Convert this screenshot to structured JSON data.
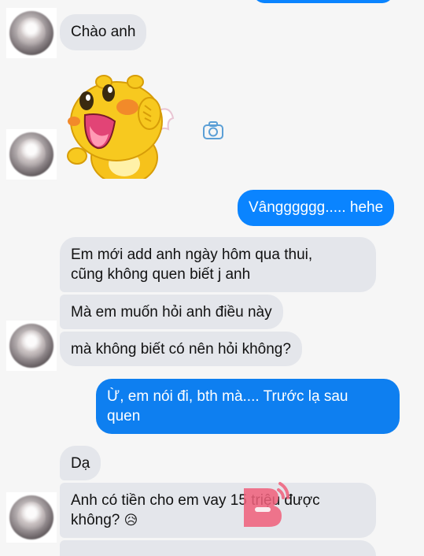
{
  "messages": [
    {
      "text": "Chào anh"
    },
    {
      "text": "Vângggggg..... hehe"
    },
    {
      "line1": "Em mới add anh ngày hôm qua thui,",
      "line2": "cũng không quen biết j anh"
    },
    {
      "text": "Mà em muốn hỏi anh điều này"
    },
    {
      "text": "mà không biết có nên hỏi không?"
    },
    {
      "line1": "Ừ, em nói đi, bth mà.... Trước lạ sau",
      "line2": "quen"
    },
    {
      "text": "Dạ"
    },
    {
      "line1": "Anh có tiền cho em vay 15 triệu được",
      "line2": "không?",
      "emoji": "😥"
    }
  ],
  "icons": {
    "sticker": "qoobee-dragon-sticker",
    "camera": "camera-icon",
    "watermark": "b-logo-watermark"
  },
  "colors": {
    "outgoing": "#0a84ff",
    "incoming": "#e4e6eb",
    "background": "#f6f6f6"
  }
}
